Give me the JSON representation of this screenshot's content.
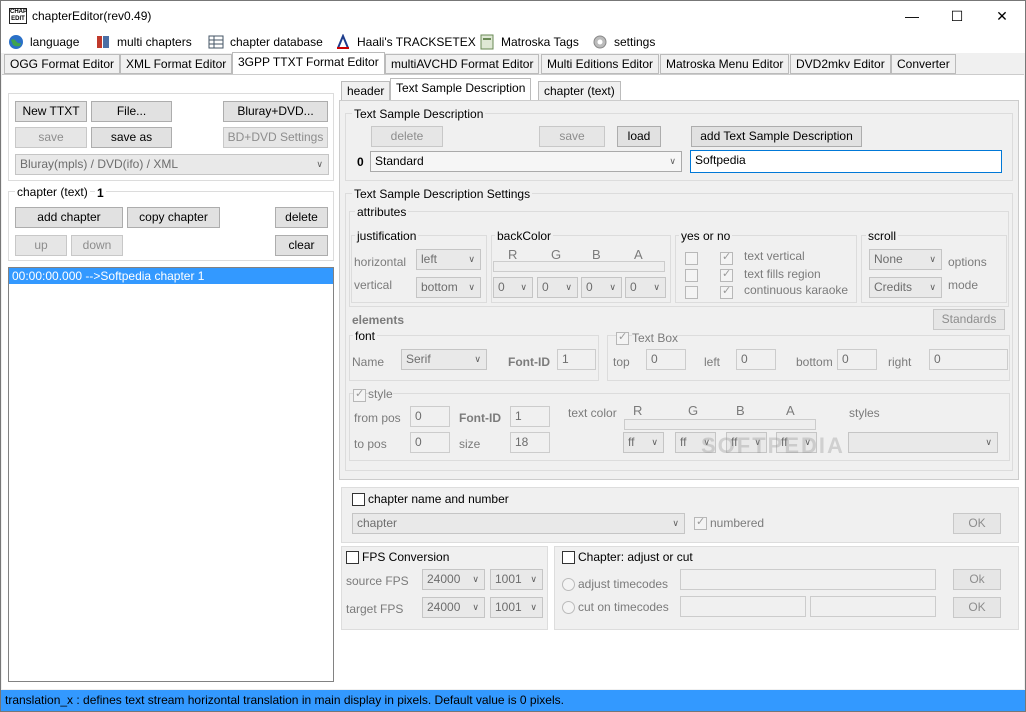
{
  "window": {
    "title": "chapterEditor(rev0.49)",
    "logo": "CHAP EDIT",
    "minimize": "—",
    "maximize": "☐",
    "close": "✕"
  },
  "menu": [
    {
      "label": "language",
      "icon": "globe-icon"
    },
    {
      "label": "multi chapters",
      "icon": "book-icon"
    },
    {
      "label": "chapter database",
      "icon": "table-icon"
    },
    {
      "label": "Haali's TRACKSETEX",
      "icon": "haali-icon"
    },
    {
      "label": "Matroska Tags",
      "icon": "tag-icon"
    },
    {
      "label": "settings",
      "icon": "gear-icon"
    }
  ],
  "tabs": [
    "OGG Format Editor",
    "XML Format Editor",
    "3GPP TTXT Format Editor",
    "multiAVCHD Format Editor",
    "Multi Editions Editor",
    "Matroska Menu Editor",
    "DVD2mkv Editor",
    "Converter"
  ],
  "left": {
    "new_ttxt": "New TTXT",
    "file": "File...",
    "bluray_dvd": "Bluray+DVD...",
    "save": "save",
    "save_as": "save as",
    "bd_dvd_settings": "BD+DVD Settings",
    "source_combo": "Bluray(mpls) / DVD(ifo) / XML",
    "chapter_group": "chapter (text)",
    "chapter_count": "1",
    "add_chapter": "add chapter",
    "copy_chapter": "copy chapter",
    "delete": "delete",
    "up": "up",
    "down": "down",
    "clear": "clear",
    "chapters": [
      "00:00:00.000 -->Softpedia chapter 1"
    ]
  },
  "subtabs": [
    "header",
    "Text Sample Description",
    "chapter (text)"
  ],
  "tsd": {
    "group": "Text Sample Description",
    "delete": "delete",
    "save": "save",
    "load": "load",
    "add": "add Text Sample Description",
    "index": "0",
    "style_combo": "Standard",
    "name_field": "Softpedia"
  },
  "settings": {
    "group": "Text Sample Description Settings",
    "attributes": "attributes",
    "justification": "justification",
    "horizontal": "horizontal",
    "horizontal_val": "left",
    "vertical": "vertical",
    "vertical_val": "bottom",
    "backcolor": "backColor",
    "rgba": [
      "R",
      "G",
      "B",
      "A"
    ],
    "backcolor_vals": [
      "0",
      "0",
      "0",
      "0"
    ],
    "yes_or_no": "yes or no",
    "text_vertical": "text vertical",
    "text_fills_region": "text fills region",
    "continuous_karaoke": "continuous karaoke",
    "scroll": "scroll",
    "scroll_val": "None",
    "options": "options",
    "mode_val": "Credits",
    "mode": "mode",
    "elements": "elements",
    "standards": "Standards",
    "font": "font",
    "name": "Name",
    "font_name_val": "Serif",
    "font_id": "Font-ID",
    "font_id_val": "1",
    "text_box": "Text Box",
    "top": "top",
    "top_val": "0",
    "left": "left",
    "left_val": "0",
    "bottom": "bottom",
    "bottom_val": "0",
    "right": "right",
    "right_val": "0",
    "style": "style",
    "from_pos": "from pos",
    "from_pos_val": "0",
    "to_pos": "to pos",
    "to_pos_val": "0",
    "font_id2": "Font-ID",
    "font_id2_val": "1",
    "size": "size",
    "size_val": "18",
    "text_color": "text color",
    "text_color_vals": [
      "ff",
      "ff",
      "ff",
      "ff"
    ],
    "styles": "styles"
  },
  "chapter_name": {
    "label": "chapter name and number",
    "combo": "chapter",
    "numbered": "numbered",
    "ok": "OK"
  },
  "fps": {
    "label": "FPS Conversion",
    "source_fps": "source FPS",
    "source_val": "24000",
    "source_div": "1001",
    "target_fps": "target FPS",
    "target_val": "24000",
    "target_div": "1001"
  },
  "adjust": {
    "label": "Chapter: adjust or cut",
    "adjust_timecodes": "adjust timecodes",
    "cut_timecodes": "cut on timecodes",
    "ok1": "Ok",
    "ok2": "OK"
  },
  "watermark": "SOFTPEDIA",
  "status": "translation_x : defines text stream horizontal translation in main display in pixels. Default value is 0 pixels."
}
